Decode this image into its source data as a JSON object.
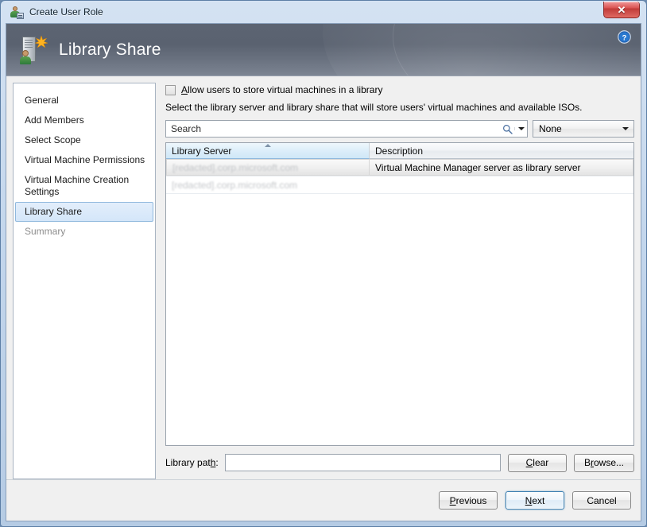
{
  "window": {
    "title": "Create User Role",
    "title_icon": "user-role-icon",
    "close_label": "✕"
  },
  "banner": {
    "title": "Library Share",
    "icon": "library-server-icon",
    "help_icon": "help-icon"
  },
  "sidebar": {
    "items": [
      {
        "label": "General",
        "state": "normal"
      },
      {
        "label": "Add Members",
        "state": "normal"
      },
      {
        "label": "Select Scope",
        "state": "normal"
      },
      {
        "label": "Virtual Machine Permissions",
        "state": "normal"
      },
      {
        "label": "Virtual Machine Creation Settings",
        "state": "normal"
      },
      {
        "label": "Library Share",
        "state": "selected"
      },
      {
        "label": "Summary",
        "state": "disabled"
      }
    ]
  },
  "main": {
    "allow_checkbox": {
      "label_prefix": "A",
      "label_rest": "llow users to store virtual machines in a library",
      "checked": false
    },
    "description": "Select the library server and library share that will store users' virtual machines and available ISOs.",
    "search": {
      "placeholder": "Search",
      "value": "",
      "icon": "magnifier-icon",
      "caret_icon": "chevron-down-icon"
    },
    "filter": {
      "value": "None",
      "caret_icon": "chevron-down-icon"
    },
    "table": {
      "columns": [
        {
          "label": "Library Server",
          "sorted": "ascending"
        },
        {
          "label": "Description",
          "sorted": "none"
        }
      ],
      "rows": [
        {
          "server": "[redacted].corp.microsoft.com",
          "description": "Virtual Machine Manager server as library server",
          "redacted": true,
          "hovered": true
        },
        {
          "server": "[redacted].corp.microsoft.com",
          "description": "",
          "redacted": true,
          "hovered": false
        }
      ]
    },
    "library_path": {
      "label_prefix": "Library pat",
      "label_accel": "h",
      "label_suffix": ":",
      "value": "",
      "clear_button": {
        "prefix": "",
        "accel": "C",
        "suffix": "lear"
      },
      "browse_button": {
        "prefix": "B",
        "accel": "r",
        "suffix": "owse..."
      }
    }
  },
  "footer": {
    "previous": {
      "prefix": "",
      "accel": "P",
      "suffix": "revious"
    },
    "next": {
      "prefix": "",
      "accel": "N",
      "suffix": "ext"
    },
    "cancel": {
      "prefix": "Cancel",
      "accel": "",
      "suffix": ""
    }
  }
}
